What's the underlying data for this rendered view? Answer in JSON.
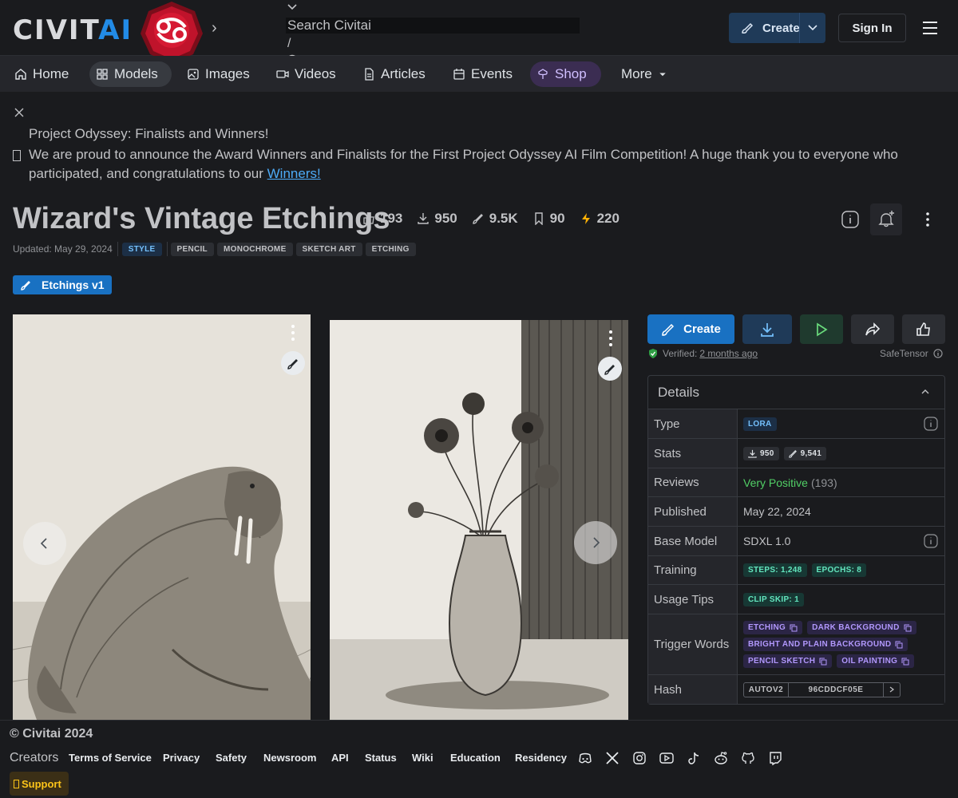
{
  "header": {
    "logo_main": "CIVIT",
    "logo_accent": "AI",
    "search_placeholder": "Search Civitai",
    "search_shortcut": "/",
    "create_label": "Create",
    "signin_label": "Sign In"
  },
  "nav": {
    "items": [
      {
        "label": "Home",
        "icon": "home-icon"
      },
      {
        "label": "Models",
        "icon": "grid-icon"
      },
      {
        "label": "Images",
        "icon": "image-icon"
      },
      {
        "label": "Videos",
        "icon": "video-icon"
      },
      {
        "label": "Articles",
        "icon": "file-icon"
      },
      {
        "label": "Events",
        "icon": "calendar-icon"
      },
      {
        "label": "Shop",
        "icon": "shop-icon"
      },
      {
        "label": "More",
        "icon": "caret-down-icon"
      }
    ]
  },
  "announcement": {
    "title": "Project Odyssey: Finalists and Winners!",
    "body": "We are proud to announce the Award Winners and Finalists for the First Project Odyssey AI Film Competition! A huge thank you to everyone who participated, and congratulations to our ",
    "link": "Winners!"
  },
  "model": {
    "title": "Wizard's Vintage Etchings",
    "stats": {
      "likes": "193",
      "downloads": "950",
      "generations": "9.5K",
      "bookmarks": "90",
      "buzz": "220"
    },
    "updated": "Updated: May 29, 2024",
    "tags": [
      "STYLE",
      "PENCIL",
      "MONOCHROME",
      "SKETCH ART",
      "ETCHING"
    ],
    "version": "Etchings v1"
  },
  "actions": {
    "create_label": "Create",
    "verified_label": "Verified:",
    "verified_time": "2 months ago",
    "file_format": "SafeTensor"
  },
  "details": {
    "title": "Details",
    "type_label": "Type",
    "type_value": "LORA",
    "stats_label": "Stats",
    "stats_downloads": "950",
    "stats_generations": "9,541",
    "reviews_label": "Reviews",
    "reviews_value": "Very Positive",
    "reviews_count": "(193)",
    "published_label": "Published",
    "published_value": "May 22, 2024",
    "base_label": "Base Model",
    "base_value": "SDXL 1.0",
    "training_label": "Training",
    "training_steps": "STEPS: 1,248",
    "training_epochs": "EPOCHS: 8",
    "usage_label": "Usage Tips",
    "usage_value": "CLIP SKIP: 1",
    "trigger_label": "Trigger Words",
    "triggers": [
      "ETCHING",
      "DARK BACKGROUND",
      "BRIGHT AND PLAIN BACKGROUND",
      "PENCIL SKETCH",
      "OIL PAINTING"
    ],
    "hash_label": "Hash",
    "hash_type": "AUTOV2",
    "hash_value": "96CDDCF05E"
  },
  "footer": {
    "copyright": "© Civitai 2024",
    "creators": "Creators",
    "links": [
      "Terms of Service",
      "Privacy",
      "Safety",
      "Newsroom",
      "API",
      "Status",
      "Wiki",
      "Education",
      "Residency"
    ],
    "support": "Support"
  }
}
